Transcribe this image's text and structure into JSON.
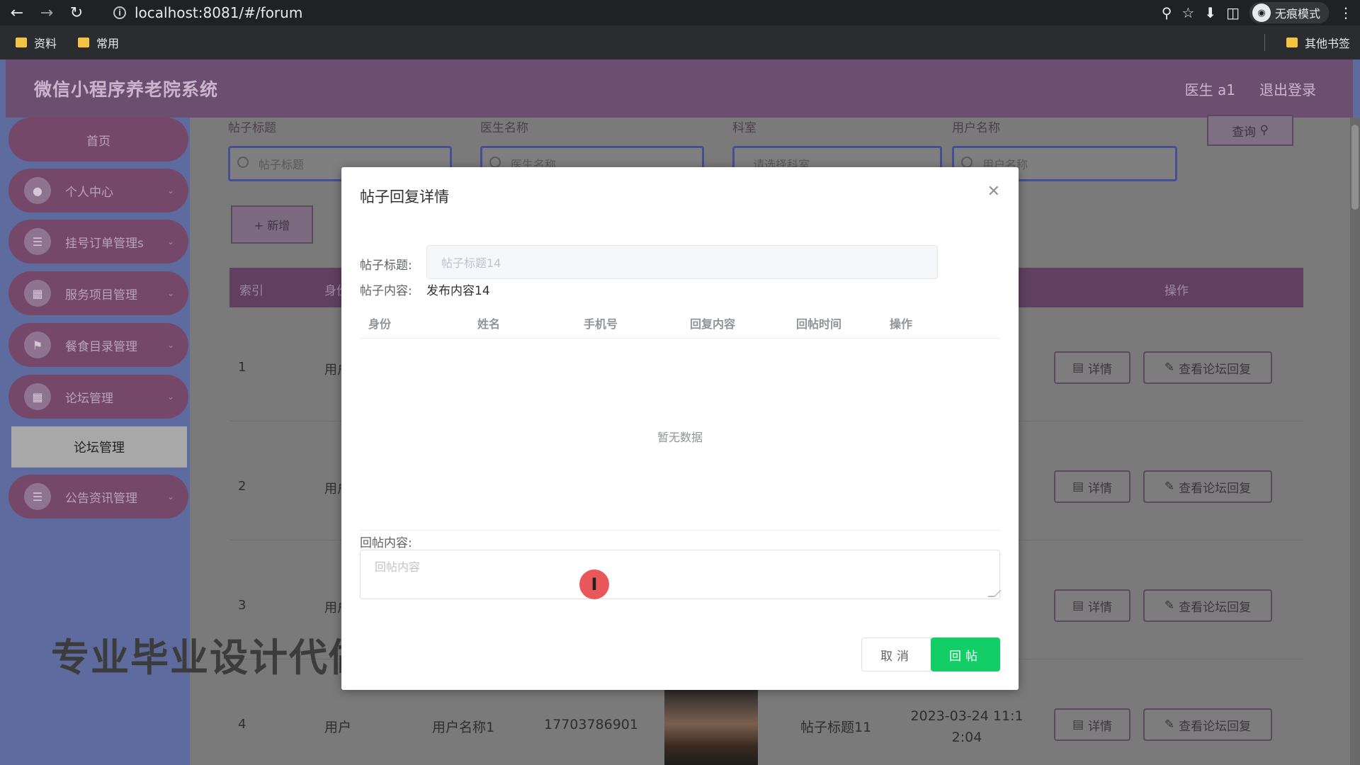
{
  "browser": {
    "url": "localhost:8081/#/forum",
    "incognito_label": "无痕模式",
    "bookmarks": [
      "资料",
      "常用"
    ],
    "other_bookmarks": "其他书签"
  },
  "header": {
    "title": "微信小程序养老院系统",
    "user": "医生 a1",
    "logout": "退出登录"
  },
  "sidebar": {
    "home": "首页",
    "items": [
      {
        "label": "个人中心",
        "icon": "person-icon"
      },
      {
        "label": "挂号订单管理s",
        "icon": "list-icon"
      },
      {
        "label": "服务项目管理",
        "icon": "grid-icon"
      },
      {
        "label": "餐食目录管理",
        "icon": "flag-icon"
      },
      {
        "label": "论坛管理",
        "icon": "grid-icon"
      },
      {
        "label": "公告资讯管理",
        "icon": "list-icon"
      }
    ],
    "active_sub": "论坛管理"
  },
  "search": {
    "fields": [
      {
        "label": "帖子标题",
        "placeholder": "帖子标题"
      },
      {
        "label": "医生名称",
        "placeholder": "医生名称"
      },
      {
        "label": "科室",
        "placeholder": "请选择科室"
      },
      {
        "label": "用户名称",
        "placeholder": "用户名称"
      }
    ],
    "query_button": "查询"
  },
  "toolbar": {
    "add_button": "+ 新增"
  },
  "table": {
    "headers": {
      "index": "索引",
      "identity": "身份",
      "actions": "操作"
    },
    "rows": [
      {
        "index": "1",
        "identity": "用户"
      },
      {
        "index": "2",
        "identity": "用户"
      },
      {
        "index": "3",
        "identity": "用户"
      },
      {
        "index": "4",
        "identity": "用户",
        "name": "用户名称1",
        "phone": "17703786901",
        "title": "帖子标题11",
        "time": "2023-03-24 11:1\n2:04"
      }
    ],
    "detail_button": "详情",
    "view_replies_button": "查看论坛回复"
  },
  "watermark": "专业毕业设计代做",
  "modal": {
    "title": "帖子回复详情",
    "post_title_label": "帖子标题:",
    "post_title_value": "帖子标题14",
    "post_content_label": "帖子内容:",
    "post_content_value": "发布内容14",
    "reply_headers": [
      "身份",
      "姓名",
      "手机号",
      "回复内容",
      "回帖时间",
      "操作"
    ],
    "empty_text": "暂无数据",
    "reply_label": "回帖内容:",
    "reply_placeholder": "回帖内容",
    "cancel": "取消",
    "submit": "回帖"
  },
  "colors": {
    "header": "#6c4f70",
    "sidebar": "#5e6b9e",
    "submit": "#13ce66"
  }
}
